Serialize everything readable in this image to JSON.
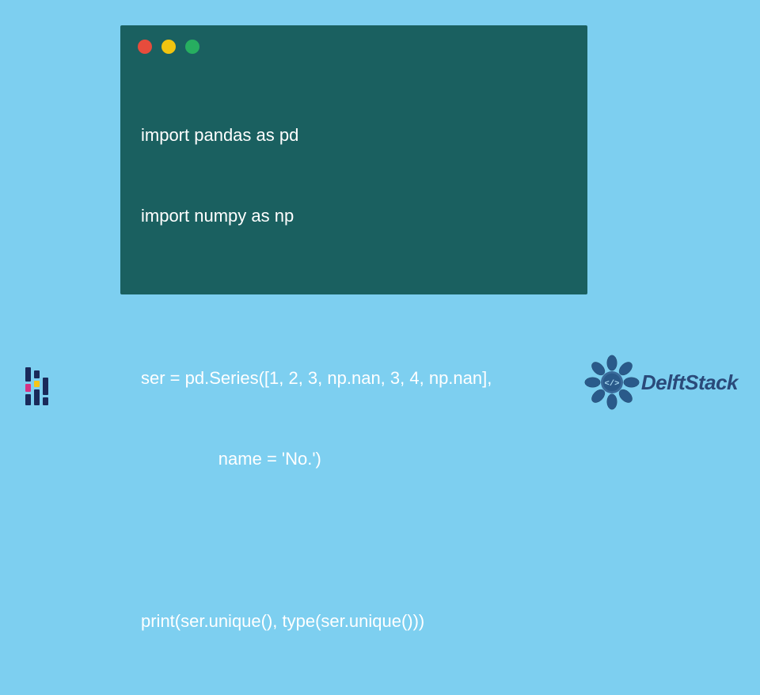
{
  "code": {
    "line1": "import pandas as pd",
    "line2": "import numpy as np",
    "line3": "ser = pd.Series([1, 2, 3, np.nan, 3, 4, np.nan],",
    "line4": "                name = 'No.')",
    "line5": "print(ser.unique(), type(ser.unique()))"
  },
  "window": {
    "bg_color": "#1a6060",
    "text_color": "#ffffff",
    "dot_red": "#e74c3c",
    "dot_yellow": "#f1c40f",
    "dot_green": "#27ae60"
  },
  "page": {
    "bg_color": "#7dcff0"
  },
  "brand": {
    "name": "DelftStack"
  },
  "left_logo": {
    "colors": {
      "navy": "#1a2a5a",
      "magenta": "#d63384",
      "yellow": "#f5c518"
    }
  }
}
